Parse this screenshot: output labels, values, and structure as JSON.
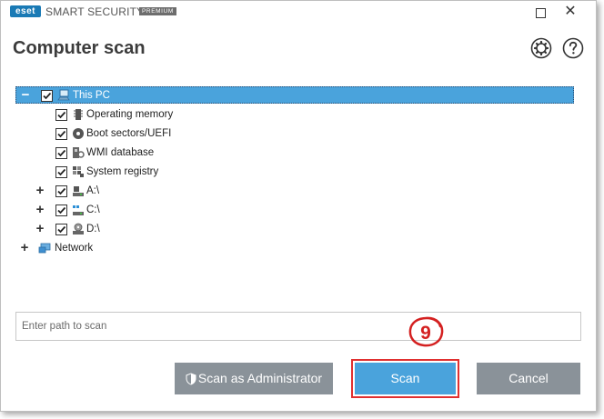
{
  "window": {
    "logo_text": "eset",
    "product_name": "SMART SECURITY",
    "edition": "PREMIUM",
    "maximize_icon": "maximize-icon",
    "close_icon": "close-icon"
  },
  "header": {
    "title": "Computer scan",
    "settings_icon": "gear-icon",
    "help_icon": "help-icon"
  },
  "tree": {
    "root": {
      "label": "This PC",
      "expanded": true,
      "checked": true,
      "selected": true
    },
    "children": [
      {
        "label": "Operating memory",
        "icon": "memory-icon",
        "checked": true
      },
      {
        "label": "Boot sectors/UEFI",
        "icon": "disc-icon",
        "checked": true
      },
      {
        "label": "WMI database",
        "icon": "database-icon",
        "checked": true
      },
      {
        "label": "System registry",
        "icon": "registry-icon",
        "checked": true
      },
      {
        "label": "A:\\",
        "icon": "drive-icon",
        "checked": true,
        "expandable": true
      },
      {
        "label": "C:\\",
        "icon": "drive-icon",
        "checked": true,
        "expandable": true
      },
      {
        "label": "D:\\",
        "icon": "optical-drive-icon",
        "checked": true,
        "expandable": true
      }
    ],
    "network": {
      "label": "Network",
      "icon": "network-icon",
      "expandable": true
    }
  },
  "path_input": {
    "placeholder": "Enter path to scan",
    "value": ""
  },
  "buttons": {
    "scan_admin": "Scan as Administrator",
    "scan": "Scan",
    "cancel": "Cancel"
  },
  "annotation": {
    "step": "9"
  },
  "colors": {
    "accent": "#4aa3dc",
    "gray_button": "#8a9299",
    "highlight": "#e03030",
    "brand": "#1a7ab5"
  }
}
